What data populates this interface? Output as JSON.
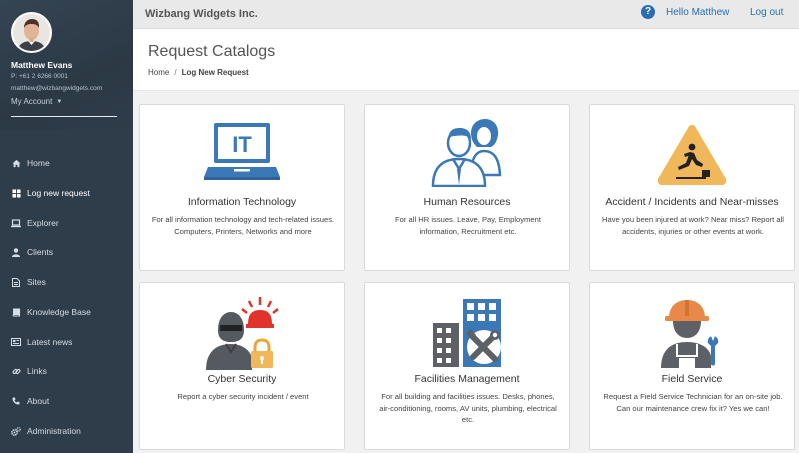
{
  "sidebar": {
    "user": {
      "name": "Matthew Evans",
      "phone": "P: +61 2 6266 0001",
      "email": "matthew@wizbangwidgets.com",
      "account_label": "My Account"
    },
    "items": [
      {
        "label": "Home",
        "icon": "home-icon"
      },
      {
        "label": "Log new request",
        "icon": "grid-icon"
      },
      {
        "label": "Explorer",
        "icon": "laptop-icon"
      },
      {
        "label": "Clients",
        "icon": "user-icon"
      },
      {
        "label": "Sites",
        "icon": "file-icon"
      },
      {
        "label": "Knowledge Base",
        "icon": "book-icon"
      },
      {
        "label": "Latest news",
        "icon": "newspaper-icon"
      },
      {
        "label": "Links",
        "icon": "link-icon"
      },
      {
        "label": "About",
        "icon": "phone-icon"
      },
      {
        "label": "Administration",
        "icon": "gears-icon"
      }
    ],
    "active_item": "Log new request"
  },
  "topbar": {
    "company": "Wizbang Widgets Inc.",
    "hello": "Hello Matthew",
    "logout": "Log out"
  },
  "header": {
    "title": "Request Catalogs",
    "breadcrumb": {
      "home": "Home",
      "separator": "/",
      "current": "Log New Request"
    }
  },
  "catalogs": [
    {
      "title": "Information Technology",
      "description": "For all information technology and tech-related issues. Computers, Printers, Networks and more",
      "icon": "laptop-it-icon"
    },
    {
      "title": "Human Resources",
      "description": "For all HR issues. Leave, Pay, Employment information, Recruitment etc.",
      "icon": "people-icon"
    },
    {
      "title": "Accident / Incidents and Near-misses",
      "description": "Have you been injured at work? Near miss? Report all accidents, injuries or other events at work.",
      "icon": "warning-fall-icon"
    },
    {
      "title": "Cyber Security",
      "description": "Report a cyber security incident / event",
      "icon": "hacker-alarm-icon"
    },
    {
      "title": "Facilities Management",
      "description": "For all building and facilities issues. Desks, phones, air-conditioning, rooms, AV units, plumbing, electrical etc.",
      "icon": "building-tools-icon"
    },
    {
      "title": "Field Service",
      "description": "Request a Field Service Technician for an on-site job. Can our maintenance crew fix it? Yes we can!",
      "icon": "technician-icon"
    }
  ],
  "colors": {
    "sidebar_bg": "#2f3c49",
    "accent_blue": "#2a6db5",
    "icon_blue": "#3a78b8",
    "warning_yellow": "#f0b85a",
    "alarm_red": "#e0342a"
  }
}
